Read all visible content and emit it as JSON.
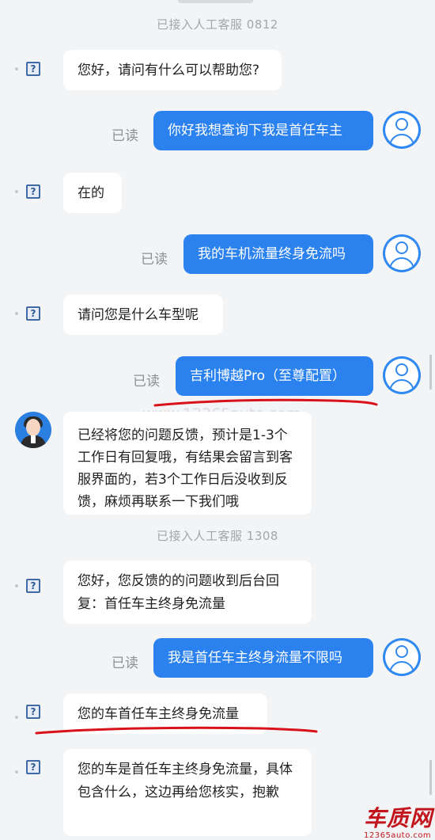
{
  "system": {
    "agent_joined_1": "已接入人工客服 0812",
    "agent_joined_2": "已接入人工客服 1308"
  },
  "messages": {
    "m1": "您好，请问有什么可以帮助您?",
    "m2": "你好我想查询下我是首任车主",
    "m3": "在的",
    "m4": "我的车机流量终身免流吗",
    "m5": "请问您是什么车型呢",
    "m6": "吉利博越Pro（至尊配置）",
    "m7": "已经将您的问题反馈，预计是1-3个工作日有回复哦，有结果会留言到客服界面的，若3个工作日后没收到反馈，麻烦再联系一下我们哦",
    "m8": "您好，您反馈的的问题收到后台回复：首任车主终身免流量",
    "m9": "我是首任车主终身流量不限吗",
    "m10": "您的车首任车主终身免流量",
    "m11": "您的车是首任车主终身免流量，具体包含什么，这边再给您核实，抱歉"
  },
  "read_label": "已读",
  "icon_glyph": "?",
  "watermark": "www.12365auto.com",
  "logo": {
    "main": "车质网",
    "sub": "12365auto.com"
  },
  "colors": {
    "user_bubble": "#2b82ee",
    "agent_bubble": "#ffffff",
    "background": "#f3f4f6",
    "annotation": "#d8121a"
  }
}
